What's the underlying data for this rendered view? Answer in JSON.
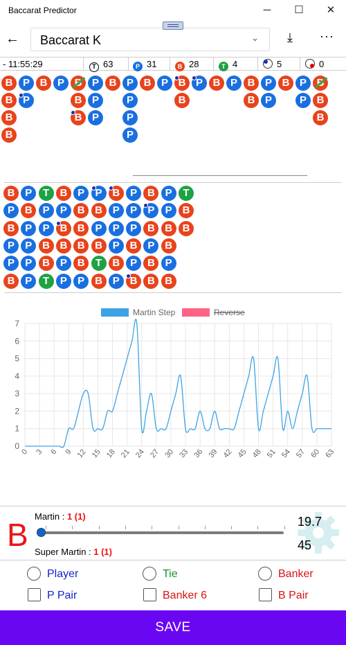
{
  "window": {
    "title": "Baccarat Predictor",
    "minimize_icon": "─",
    "maximize_icon": "☐",
    "close_icon": "✕"
  },
  "header": {
    "selected_table": "Baccarat K",
    "back_icon": "←",
    "chevron_icon": "⌄",
    "download_icon": "⤓",
    "more_icon": "···"
  },
  "stats": {
    "time": "- 11:55:29",
    "tie": "63",
    "player": "31",
    "banker": "28",
    "tie_count": "4",
    "player_pair": "5",
    "banker_pair": "0",
    "tie_letter": "T",
    "player_letter": "P",
    "banker_letter": "B"
  },
  "big_road": [
    {
      "col": 0,
      "beads": [
        "B",
        "B",
        "B",
        "B"
      ]
    },
    {
      "col": 1,
      "beads": [
        "P",
        "P"
      ],
      "dots": [
        1
      ]
    },
    {
      "col": 2,
      "beads": [
        "B"
      ]
    },
    {
      "col": 3,
      "beads": [
        "P"
      ]
    },
    {
      "col": 4,
      "beads": [
        "B",
        "B",
        "B"
      ],
      "slash": [
        0
      ],
      "dots": [
        2
      ]
    },
    {
      "col": 5,
      "beads": [
        "P",
        "P",
        "P"
      ]
    },
    {
      "col": 6,
      "beads": [
        "B"
      ]
    },
    {
      "col": 7,
      "beads": [
        "P",
        "P",
        "P",
        "P"
      ]
    },
    {
      "col": 8,
      "beads": [
        "B"
      ]
    },
    {
      "col": 9,
      "beads": [
        "P"
      ]
    },
    {
      "col": 10,
      "beads": [
        "B",
        "B"
      ],
      "dots": [
        0
      ]
    },
    {
      "col": 11,
      "beads": [
        "P"
      ],
      "dots": [
        0
      ]
    },
    {
      "col": 12,
      "beads": [
        "B"
      ]
    },
    {
      "col": 13,
      "beads": [
        "P"
      ]
    },
    {
      "col": 14,
      "beads": [
        "B",
        "B"
      ]
    },
    {
      "col": 15,
      "beads": [
        "P",
        "P"
      ]
    },
    {
      "col": 16,
      "beads": [
        "B"
      ]
    },
    {
      "col": 17,
      "beads": [
        "P",
        "P"
      ]
    },
    {
      "col": 18,
      "beads": [
        "B",
        "B",
        "B"
      ],
      "slash": [
        0
      ]
    }
  ],
  "bead_plate": [
    [
      "B",
      "P",
      "T",
      "B",
      "P",
      "P",
      "B",
      "P",
      "B",
      "P",
      "T"
    ],
    [
      "P",
      "B",
      "P",
      "P",
      "B",
      "B",
      "P",
      "P",
      "P",
      "P",
      "B"
    ],
    [
      "B",
      "P",
      "P",
      "B",
      "B",
      "P",
      "P",
      "P",
      "B",
      "B",
      "B"
    ],
    [
      "P",
      "P",
      "B",
      "B",
      "B",
      "B",
      "P",
      "B",
      "P",
      "B"
    ],
    [
      "P",
      "P",
      "B",
      "P",
      "B",
      "T",
      "B",
      "P",
      "B",
      "P"
    ],
    [
      "B",
      "P",
      "T",
      "P",
      "P",
      "B",
      "P",
      "B",
      "B",
      "B"
    ]
  ],
  "bead_plate_dots": [
    [
      0,
      5
    ],
    [
      0,
      6
    ],
    [
      1,
      8
    ],
    [
      2,
      3
    ],
    [
      5,
      7
    ]
  ],
  "chart_data": {
    "type": "line",
    "legend": [
      {
        "name": "Martin Step",
        "color": "#3ea2e6",
        "struck": false
      },
      {
        "name": "Reverse",
        "color": "#ff6384",
        "struck": true
      }
    ],
    "xlim": [
      0,
      63
    ],
    "ylim": [
      0,
      7
    ],
    "x_ticks": [
      0,
      3,
      6,
      9,
      12,
      15,
      18,
      21,
      24,
      27,
      30,
      33,
      36,
      39,
      42,
      45,
      48,
      51,
      54,
      57,
      60,
      63
    ],
    "y_ticks": [
      0,
      1,
      2,
      3,
      4,
      5,
      6,
      7
    ],
    "series": [
      {
        "name": "Martin Step",
        "values": [
          0,
          0,
          0,
          0,
          0,
          0,
          0,
          0,
          0,
          1,
          1,
          2,
          3,
          3,
          1,
          1,
          1,
          2,
          2,
          3,
          4,
          5,
          6,
          7,
          1,
          2,
          3,
          1,
          1,
          1,
          2,
          3,
          4,
          1,
          1,
          1,
          2,
          1,
          1,
          2,
          1,
          1,
          1,
          1,
          2,
          3,
          4,
          5,
          1,
          2,
          3,
          4,
          5,
          1,
          2,
          1,
          2,
          3,
          4,
          1,
          1,
          1,
          1,
          1
        ]
      }
    ]
  },
  "bottom": {
    "prediction": "B",
    "martin_label": "Martin : ",
    "martin_value": "1 (1)",
    "super_martin_label": "Super Martin : ",
    "super_martin_value": "1 (1)",
    "value_top": "19.7",
    "value_bottom": "45",
    "gear_icon": "gear-icon"
  },
  "options": {
    "player": "Player",
    "tie": "Tie",
    "banker": "Banker",
    "p_pair": "P Pair",
    "banker6": "Banker 6",
    "b_pair": "B Pair"
  },
  "save_label": "SAVE",
  "colors": {
    "banker": "#e8431c",
    "player": "#1a6fe0",
    "tie": "#1ea243",
    "accent": "#6a07f2"
  }
}
